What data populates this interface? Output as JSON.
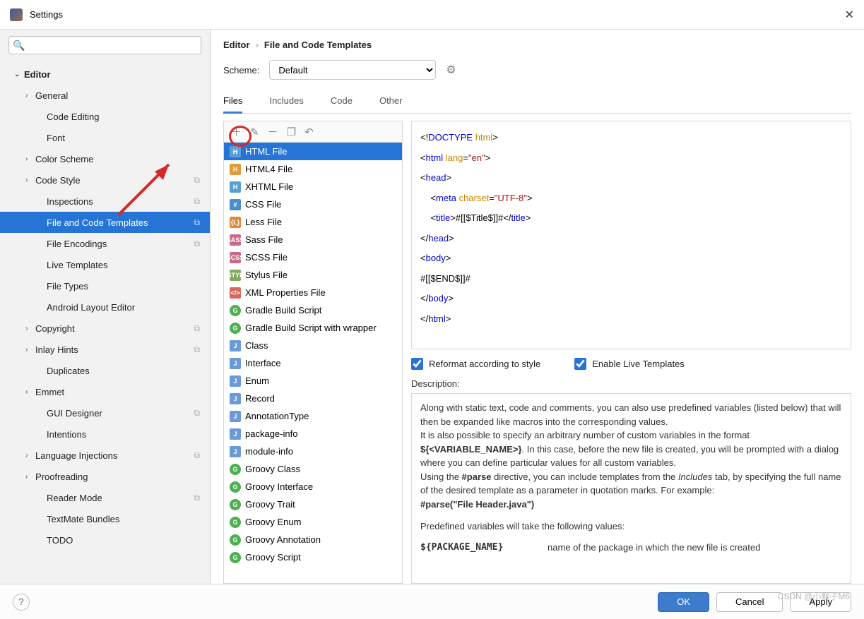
{
  "window": {
    "title": "Settings"
  },
  "search": {
    "placeholder": ""
  },
  "tree": [
    {
      "label": "Editor",
      "lvl": 0,
      "chev": "⌄",
      "bold": true
    },
    {
      "label": "General",
      "lvl": 1,
      "chev": "›"
    },
    {
      "label": "Code Editing",
      "lvl": 2
    },
    {
      "label": "Font",
      "lvl": 2
    },
    {
      "label": "Color Scheme",
      "lvl": 1,
      "chev": "›"
    },
    {
      "label": "Code Style",
      "lvl": 1,
      "chev": "›",
      "suffix": "⧉"
    },
    {
      "label": "Inspections",
      "lvl": 2,
      "suffix": "⧉"
    },
    {
      "label": "File and Code Templates",
      "lvl": 2,
      "selected": true,
      "suffix": "⧉"
    },
    {
      "label": "File Encodings",
      "lvl": 2,
      "suffix": "⧉"
    },
    {
      "label": "Live Templates",
      "lvl": 2
    },
    {
      "label": "File Types",
      "lvl": 2
    },
    {
      "label": "Android Layout Editor",
      "lvl": 2
    },
    {
      "label": "Copyright",
      "lvl": 1,
      "chev": "›",
      "suffix": "⧉"
    },
    {
      "label": "Inlay Hints",
      "lvl": 1,
      "chev": "›",
      "suffix": "⧉"
    },
    {
      "label": "Duplicates",
      "lvl": 2
    },
    {
      "label": "Emmet",
      "lvl": 1,
      "chev": "›"
    },
    {
      "label": "GUI Designer",
      "lvl": 2,
      "suffix": "⧉"
    },
    {
      "label": "Intentions",
      "lvl": 2
    },
    {
      "label": "Language Injections",
      "lvl": 1,
      "chev": "›",
      "suffix": "⧉"
    },
    {
      "label": "Proofreading",
      "lvl": 1,
      "chev": "›"
    },
    {
      "label": "Reader Mode",
      "lvl": 2,
      "suffix": "⧉"
    },
    {
      "label": "TextMate Bundles",
      "lvl": 2
    },
    {
      "label": "TODO",
      "lvl": 2
    }
  ],
  "breadcrumb": {
    "a": "Editor",
    "b": "File and Code Templates"
  },
  "scheme": {
    "label": "Scheme:",
    "value": "Default"
  },
  "tabs": {
    "a": "Files",
    "b": "Includes",
    "c": "Code",
    "d": "Other"
  },
  "toolbar": {
    "add": "＋",
    "edit": "✎",
    "remove": "－",
    "copy": "❐",
    "undo": "↶"
  },
  "templates": [
    {
      "label": "HTML File",
      "cls": "ico-h5",
      "t": "H",
      "selected": true
    },
    {
      "label": "HTML4 File",
      "cls": "ico-h4",
      "t": "H"
    },
    {
      "label": "XHTML File",
      "cls": "ico-h5",
      "t": "H"
    },
    {
      "label": "CSS File",
      "cls": "ico-css",
      "t": "#"
    },
    {
      "label": "Less File",
      "cls": "ico-less",
      "t": "{L}"
    },
    {
      "label": "Sass File",
      "cls": "ico-sass",
      "t": "SASS"
    },
    {
      "label": "SCSS File",
      "cls": "ico-scss",
      "t": "SCSS"
    },
    {
      "label": "Stylus File",
      "cls": "ico-styl",
      "t": "STYL"
    },
    {
      "label": "XML Properties File",
      "cls": "ico-xml",
      "t": "</>"
    },
    {
      "label": "Gradle Build Script",
      "cls": "ico-g",
      "t": "G"
    },
    {
      "label": "Gradle Build Script with wrapper",
      "cls": "ico-g",
      "t": "G"
    },
    {
      "label": "Class",
      "cls": "ico-j",
      "t": "J"
    },
    {
      "label": "Interface",
      "cls": "ico-j",
      "t": "J"
    },
    {
      "label": "Enum",
      "cls": "ico-j",
      "t": "J"
    },
    {
      "label": "Record",
      "cls": "ico-j",
      "t": "J"
    },
    {
      "label": "AnnotationType",
      "cls": "ico-j",
      "t": "J"
    },
    {
      "label": "package-info",
      "cls": "ico-j",
      "t": "J"
    },
    {
      "label": "module-info",
      "cls": "ico-j",
      "t": "J"
    },
    {
      "label": "Groovy Class",
      "cls": "ico-g",
      "t": "G"
    },
    {
      "label": "Groovy Interface",
      "cls": "ico-g",
      "t": "G"
    },
    {
      "label": "Groovy Trait",
      "cls": "ico-g",
      "t": "G"
    },
    {
      "label": "Groovy Enum",
      "cls": "ico-g",
      "t": "G"
    },
    {
      "label": "Groovy Annotation",
      "cls": "ico-g",
      "t": "G"
    },
    {
      "label": "Groovy Script",
      "cls": "ico-g",
      "t": "G"
    }
  ],
  "code": {
    "l1a": "<!",
    "l1b": "DOCTYPE ",
    "l1c": "html",
    "l1d": ">",
    "l2a": "<",
    "l2b": "html ",
    "l2c": "lang",
    "l2d": "=",
    "l2e": "\"en\"",
    "l2f": ">",
    "l3a": "<",
    "l3b": "head",
    "l3c": ">",
    "l4pad": "    ",
    "l4a": "<",
    "l4b": "meta ",
    "l4c": "charset",
    "l4d": "=",
    "l4e": "\"UTF-8\"",
    "l4f": ">",
    "l5pad": "    ",
    "l5a": "<",
    "l5b": "title",
    "l5c": ">",
    "l5d": "#[[$Title$]]#",
    "l5e": "</",
    "l5f": "title",
    "l5g": ">",
    "l6a": "</",
    "l6b": "head",
    "l6c": ">",
    "l7a": "<",
    "l7b": "body",
    "l7c": ">",
    "l8": "#[[$END$]]#",
    "l9a": "</",
    "l9b": "body",
    "l9c": ">",
    "l10a": "</",
    "l10b": "html",
    "l10c": ">"
  },
  "opts": {
    "reformat": "Reformat according to style",
    "live": "Enable Live Templates"
  },
  "desc": {
    "label": "Description:",
    "p1": "Along with static text, code and comments, you can also use predefined variables (listed below) that will then be expanded like macros into the corresponding values.",
    "p2a": "It is also possible to specify an arbitrary number of custom variables in the format ",
    "p2b": "${<VARIABLE_NAME>}",
    "p2c": ". In this case, before the new file is created, you will be prompted with a dialog where you can define particular values for all custom variables.",
    "p3a": "Using the ",
    "p3b": "#parse",
    "p3c": " directive, you can include templates from the ",
    "p3d": "Includes",
    "p3e": " tab, by specifying the full name of the desired template as a parameter in quotation marks. For example:",
    "p3f": "#parse(\"File Header.java\")",
    "p4": "Predefined variables will take the following values:",
    "var1": "${PACKAGE_NAME}",
    "var1d": "name of the package in which the new file is created"
  },
  "buttons": {
    "ok": "OK",
    "cancel": "Cancel",
    "apply": "Apply"
  },
  "watermark": "CSDN @小猴子M6"
}
